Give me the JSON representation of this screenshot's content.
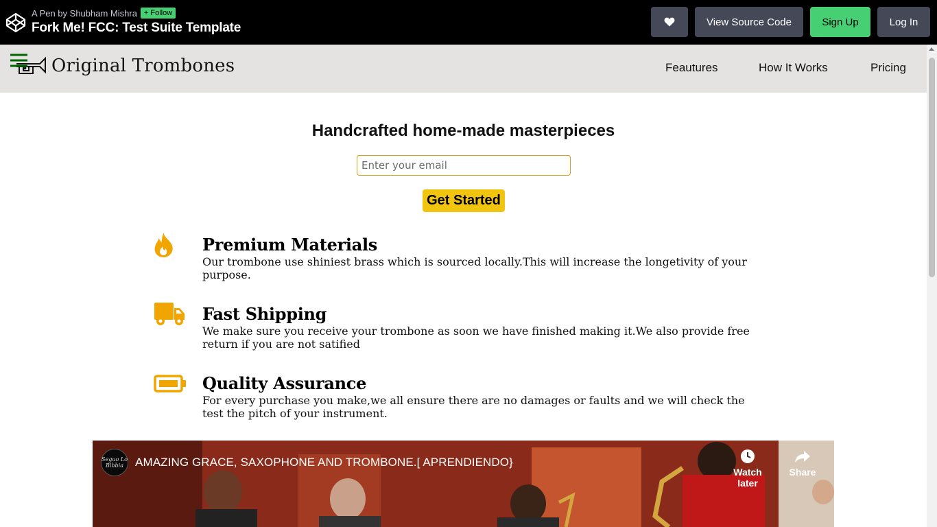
{
  "codepen": {
    "byline": "A Pen by Shubham Mishra",
    "follow_label": "Follow",
    "title": "Fork Me! FCC: Test Suite Template",
    "view_source_label": "View Source Code",
    "signup_label": "Sign Up",
    "login_label": "Log In"
  },
  "header": {
    "brand": "Original Trombones",
    "nav": [
      "Feautures",
      "How It Works",
      "Pricing"
    ]
  },
  "hero": {
    "title": "Handcrafted home-made masterpieces",
    "email_placeholder": "Enter your email",
    "cta_label": "Get Started"
  },
  "features": [
    {
      "icon": "fire-icon",
      "title": "Premium Materials",
      "description": "Our trombone use shiniest brass which is sourced locally.This will increase the longetivity of your purpose."
    },
    {
      "icon": "truck-icon",
      "title": "Fast Shipping",
      "description": "We make sure you receive your trombone as soon we have finished making it.We also provide free return if you are not satified"
    },
    {
      "icon": "battery-icon",
      "title": "Quality Assurance",
      "description": "For every purchase you make,we all ensure there are no damages or faults and we will check the test the pitch of your instrument."
    }
  ],
  "video": {
    "channel_avatar_text": "Seguo Lo Bibbia",
    "title": "AMAZING GRACE, SAXOPHONE AND TROMBONE.[ APRENDIENDO}",
    "watch_later_label": "Watch later",
    "share_label": "Share"
  },
  "colors": {
    "accent": "#f1c40f",
    "icon": "#f0a500",
    "codepen_green": "#47cf73",
    "header_bg": "#e4e3e1"
  }
}
